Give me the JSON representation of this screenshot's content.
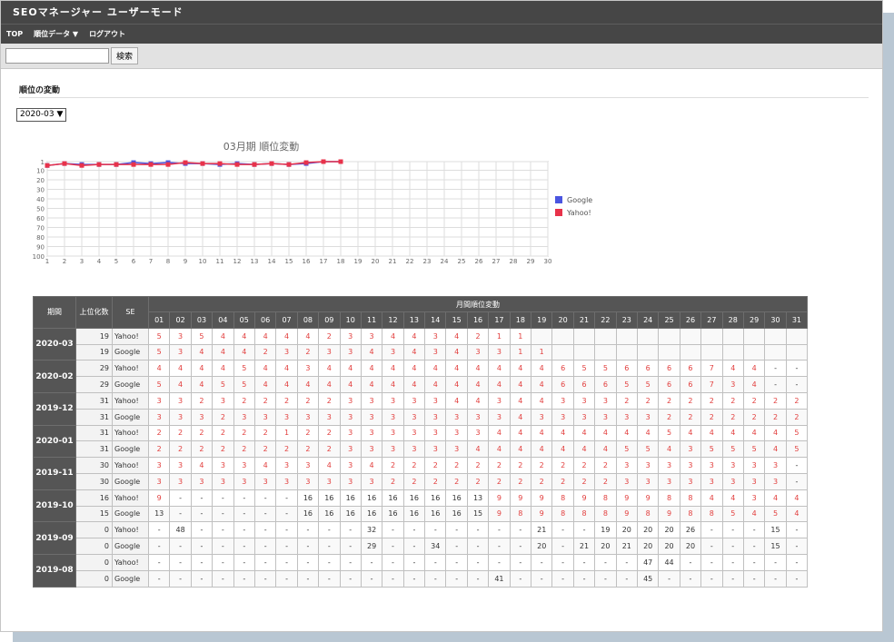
{
  "app": {
    "title": "SEOマネージャー ユーザーモード"
  },
  "nav": {
    "top": "TOP",
    "ranking": "順位データ ▼",
    "logout": "ログアウト"
  },
  "search": {
    "value": "",
    "button": "検索"
  },
  "section": {
    "title": "順位の変動"
  },
  "month_select": {
    "value": "2020-03 ▼"
  },
  "chart_data": {
    "type": "line",
    "title": "03月期 順位変動",
    "x": [
      1,
      2,
      3,
      4,
      5,
      6,
      7,
      8,
      9,
      10,
      11,
      12,
      13,
      14,
      15,
      16,
      17,
      18,
      19,
      20,
      21,
      22,
      23,
      24,
      25,
      26,
      27,
      28,
      29,
      30
    ],
    "xlim": [
      1,
      30
    ],
    "ylim": [
      1,
      100
    ],
    "y_reversed": true,
    "yticks": [
      1,
      10,
      20,
      30,
      40,
      50,
      60,
      70,
      80,
      90,
      100
    ],
    "grid": true,
    "legend_position": "right",
    "series": [
      {
        "name": "Google",
        "color": "#4a55e0",
        "values": [
          5,
          3,
          4,
          4,
          4,
          2,
          3,
          2,
          3,
          3,
          4,
          3,
          4,
          3,
          4,
          3,
          1,
          1
        ]
      },
      {
        "name": "Yahoo!",
        "color": "#e8324a",
        "values": [
          5,
          3,
          5,
          4,
          4,
          4,
          4,
          4,
          2,
          3,
          3,
          4,
          4,
          3,
          4,
          2,
          1,
          1
        ]
      }
    ]
  },
  "table": {
    "headers": {
      "period": "期間",
      "count": "上位化数",
      "se": "SE",
      "month": "月間順位変動"
    },
    "days": [
      "01",
      "02",
      "03",
      "04",
      "05",
      "06",
      "07",
      "08",
      "09",
      "10",
      "11",
      "12",
      "13",
      "14",
      "15",
      "16",
      "17",
      "18",
      "19",
      "20",
      "21",
      "22",
      "23",
      "24",
      "25",
      "26",
      "27",
      "28",
      "29",
      "30",
      "31"
    ],
    "groups": [
      {
        "period": "2020-03",
        "rows": [
          {
            "count": "19",
            "se": "Yahoo!",
            "cells": [
              "5",
              "3",
              "5",
              "4",
              "4",
              "4",
              "4",
              "4",
              "2",
              "3",
              "3",
              "4",
              "4",
              "3",
              "4",
              "2",
              "1",
              "1",
              "",
              "",
              "",
              "",
              "",
              "",
              "",
              "",
              "",
              "",
              "",
              "",
              ""
            ]
          },
          {
            "count": "19",
            "se": "Google",
            "cells": [
              "5",
              "3",
              "4",
              "4",
              "4",
              "2",
              "3",
              "2",
              "3",
              "3",
              "4",
              "3",
              "4",
              "3",
              "4",
              "3",
              "3",
              "1",
              "1",
              "",
              "",
              "",
              "",
              "",
              "",
              "",
              "",
              "",
              "",
              "",
              ""
            ]
          }
        ]
      },
      {
        "period": "2020-02",
        "rows": [
          {
            "count": "29",
            "se": "Yahoo!",
            "cells": [
              "4",
              "4",
              "4",
              "4",
              "5",
              "4",
              "4",
              "3",
              "4",
              "4",
              "4",
              "4",
              "4",
              "4",
              "4",
              "4",
              "4",
              "4",
              "4",
              "6",
              "5",
              "5",
              "6",
              "6",
              "6",
              "6",
              "7",
              "4",
              "4",
              "-",
              "-"
            ]
          },
          {
            "count": "29",
            "se": "Google",
            "cells": [
              "5",
              "4",
              "4",
              "5",
              "5",
              "4",
              "4",
              "4",
              "4",
              "4",
              "4",
              "4",
              "4",
              "4",
              "4",
              "4",
              "4",
              "4",
              "4",
              "6",
              "6",
              "6",
              "5",
              "5",
              "6",
              "6",
              "7",
              "3",
              "4",
              "-",
              "-"
            ]
          }
        ]
      },
      {
        "period": "2019-12",
        "rows": [
          {
            "count": "31",
            "se": "Yahoo!",
            "cells": [
              "3",
              "3",
              "2",
              "3",
              "2",
              "2",
              "2",
              "2",
              "2",
              "3",
              "3",
              "3",
              "3",
              "3",
              "4",
              "4",
              "3",
              "4",
              "4",
              "3",
              "3",
              "3",
              "2",
              "2",
              "2",
              "2",
              "2",
              "2",
              "2",
              "2",
              "2"
            ]
          },
          {
            "count": "31",
            "se": "Google",
            "cells": [
              "3",
              "3",
              "3",
              "2",
              "3",
              "3",
              "3",
              "3",
              "3",
              "3",
              "3",
              "3",
              "3",
              "3",
              "3",
              "3",
              "3",
              "4",
              "3",
              "3",
              "3",
              "3",
              "3",
              "3",
              "2",
              "2",
              "2",
              "2",
              "2",
              "2",
              "2"
            ]
          }
        ]
      },
      {
        "period": "2020-01",
        "rows": [
          {
            "count": "31",
            "se": "Yahoo!",
            "cells": [
              "2",
              "2",
              "2",
              "2",
              "2",
              "2",
              "1",
              "2",
              "2",
              "3",
              "3",
              "3",
              "3",
              "3",
              "3",
              "3",
              "4",
              "4",
              "4",
              "4",
              "4",
              "4",
              "4",
              "4",
              "5",
              "4",
              "4",
              "4",
              "4",
              "4",
              "5"
            ]
          },
          {
            "count": "31",
            "se": "Google",
            "cells": [
              "2",
              "2",
              "2",
              "2",
              "2",
              "2",
              "2",
              "2",
              "2",
              "3",
              "3",
              "3",
              "3",
              "3",
              "3",
              "4",
              "4",
              "4",
              "4",
              "4",
              "4",
              "4",
              "5",
              "5",
              "4",
              "3",
              "5",
              "5",
              "5",
              "4",
              "5"
            ]
          }
        ]
      },
      {
        "period": "2019-11",
        "rows": [
          {
            "count": "30",
            "se": "Yahoo!",
            "cells": [
              "3",
              "3",
              "4",
              "3",
              "3",
              "4",
              "3",
              "3",
              "4",
              "3",
              "4",
              "2",
              "2",
              "2",
              "2",
              "2",
              "2",
              "2",
              "2",
              "2",
              "2",
              "2",
              "3",
              "3",
              "3",
              "3",
              "3",
              "3",
              "3",
              "3",
              "-"
            ]
          },
          {
            "count": "30",
            "se": "Google",
            "cells": [
              "3",
              "3",
              "3",
              "3",
              "3",
              "3",
              "3",
              "3",
              "3",
              "3",
              "3",
              "2",
              "2",
              "2",
              "2",
              "2",
              "2",
              "2",
              "2",
              "2",
              "2",
              "2",
              "3",
              "3",
              "3",
              "3",
              "3",
              "3",
              "3",
              "3",
              "-"
            ]
          }
        ]
      },
      {
        "period": "2019-10",
        "rows": [
          {
            "count": "16",
            "se": "Yahoo!",
            "cells": [
              "9",
              "-",
              "-",
              "-",
              "-",
              "-",
              "-",
              "16",
              "16",
              "16",
              "16",
              "16",
              "16",
              "16",
              "16",
              "13",
              "9",
              "9",
              "9",
              "8",
              "9",
              "8",
              "9",
              "9",
              "8",
              "8",
              "4",
              "4",
              "3",
              "4",
              "4"
            ]
          },
          {
            "count": "15",
            "se": "Google",
            "cells": [
              "13",
              "-",
              "-",
              "-",
              "-",
              "-",
              "-",
              "16",
              "16",
              "16",
              "16",
              "16",
              "16",
              "16",
              "16",
              "15",
              "9",
              "8",
              "9",
              "8",
              "8",
              "8",
              "9",
              "8",
              "9",
              "8",
              "8",
              "5",
              "4",
              "5",
              "4"
            ]
          }
        ]
      },
      {
        "period": "2019-09",
        "rows": [
          {
            "count": "0",
            "se": "Yahoo!",
            "cells": [
              "-",
              "48",
              "-",
              "-",
              "-",
              "-",
              "-",
              "-",
              "-",
              "-",
              "32",
              "-",
              "-",
              "-",
              "-",
              "-",
              "-",
              "-",
              "21",
              "-",
              "-",
              "19",
              "20",
              "20",
              "20",
              "26",
              "-",
              "-",
              "-",
              "15",
              "-"
            ]
          },
          {
            "count": "0",
            "se": "Google",
            "cells": [
              "-",
              "-",
              "-",
              "-",
              "-",
              "-",
              "-",
              "-",
              "-",
              "-",
              "29",
              "-",
              "-",
              "34",
              "-",
              "-",
              "-",
              "-",
              "20",
              "-",
              "21",
              "20",
              "21",
              "20",
              "20",
              "20",
              "-",
              "-",
              "-",
              "15",
              "-"
            ]
          }
        ]
      },
      {
        "period": "2019-08",
        "rows": [
          {
            "count": "0",
            "se": "Yahoo!",
            "cells": [
              "-",
              "-",
              "-",
              "-",
              "-",
              "-",
              "-",
              "-",
              "-",
              "-",
              "-",
              "-",
              "-",
              "-",
              "-",
              "-",
              "-",
              "-",
              "-",
              "-",
              "-",
              "-",
              "-",
              "47",
              "44",
              "-",
              "-",
              "-",
              "-",
              "-",
              "-"
            ]
          },
          {
            "count": "0",
            "se": "Google",
            "cells": [
              "-",
              "-",
              "-",
              "-",
              "-",
              "-",
              "-",
              "-",
              "-",
              "-",
              "-",
              "-",
              "-",
              "-",
              "-",
              "-",
              "41",
              "-",
              "-",
              "-",
              "-",
              "-",
              "-",
              "45",
              "-",
              "-",
              "-",
              "-",
              "-",
              "-",
              "-"
            ]
          }
        ]
      }
    ]
  }
}
